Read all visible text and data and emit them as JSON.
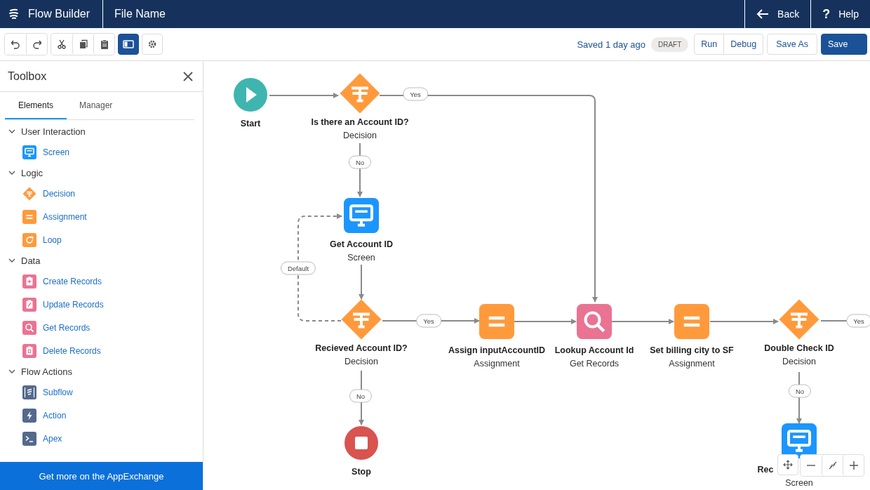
{
  "header": {
    "app_title": "Flow Builder",
    "file_name": "File Name",
    "back": "Back",
    "help_icon": "?",
    "help": "Help"
  },
  "toolbar": {
    "panel_toggle": {
      "selected": true
    },
    "status": "Saved 1 day ago",
    "badge": "DRAFT",
    "buttons": [
      {
        "label": "Run",
        "kind": "grouped"
      },
      {
        "label": "Debug",
        "kind": "grouped"
      },
      {
        "label": "Save As",
        "kind": "neutral"
      },
      {
        "label": "Save",
        "kind": "brand"
      }
    ]
  },
  "toolbox": {
    "title": "Toolbox",
    "tabs": [
      {
        "label": "Elements",
        "selected": true
      },
      {
        "label": "Manager",
        "selected": false
      }
    ],
    "sections": [
      {
        "label": "User Interaction",
        "expanded": true,
        "items": [
          {
            "label": "Screen",
            "kind": "screen"
          }
        ]
      },
      {
        "label": "Logic",
        "expanded": true,
        "items": [
          {
            "label": "Decision",
            "kind": "decision"
          },
          {
            "label": "Assignment",
            "kind": "assignment"
          },
          {
            "label": "Loop",
            "kind": "loop"
          }
        ]
      },
      {
        "label": "Data",
        "expanded": true,
        "items": [
          {
            "label": "Create Records",
            "kind": "create"
          },
          {
            "label": "Update Records",
            "kind": "update"
          },
          {
            "label": "Get Records",
            "kind": "get"
          },
          {
            "label": "Delete Records",
            "kind": "delete"
          }
        ]
      },
      {
        "label": "Flow Actions",
        "expanded": true,
        "items": [
          {
            "label": "Subflow",
            "kind": "subflow"
          },
          {
            "label": "Action",
            "kind": "action"
          },
          {
            "label": "Apex",
            "kind": "apex"
          }
        ]
      }
    ],
    "footer": "Get more on the AppExchange"
  },
  "canvas": {
    "nodes": [
      {
        "kind": "start",
        "name": "Start"
      },
      {
        "kind": "decision",
        "name": "Is there an Account ID?",
        "type": "Decision"
      },
      {
        "kind": "screen",
        "name": "Get Account ID",
        "type": "Screen"
      },
      {
        "kind": "decision",
        "name": "Recieved Account ID?",
        "type": "Decision"
      },
      {
        "kind": "stop",
        "name": "Stop"
      },
      {
        "kind": "assignment",
        "name": "Assign inputAccountID",
        "type": "Assignment"
      },
      {
        "kind": "get",
        "name": "Lookup Account Id",
        "type": "Get Records"
      },
      {
        "kind": "assignment",
        "name": "Set billing city to SF",
        "type": "Assignment"
      },
      {
        "kind": "decision",
        "name": "Double Check ID",
        "type": "Decision"
      },
      {
        "kind": "screen",
        "name": "Rec",
        "type": "Screen"
      }
    ],
    "connector_labels": [
      "Yes",
      "No",
      "Default",
      "Yes",
      "No",
      "Yes",
      "No"
    ]
  }
}
